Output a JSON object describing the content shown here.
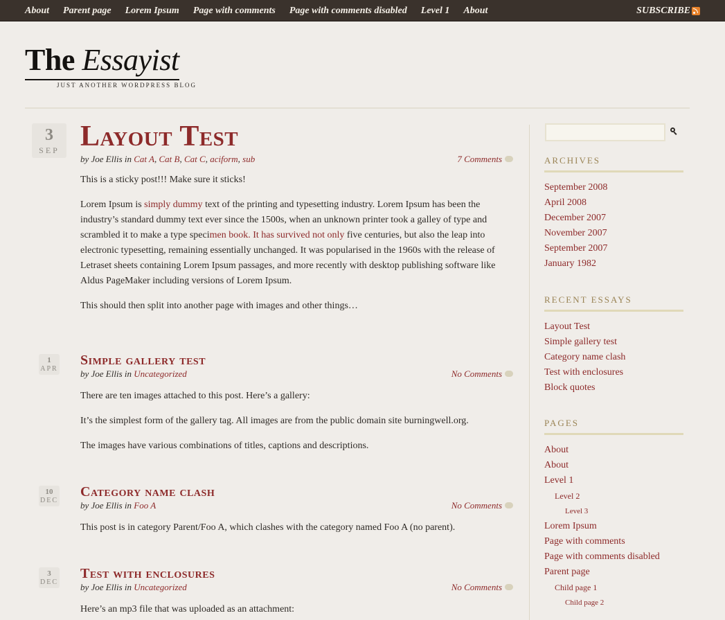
{
  "nav": {
    "items": [
      "About",
      "Parent page",
      "Lorem Ipsum",
      "Page with comments",
      "Page with comments disabled",
      "Level 1",
      "About"
    ],
    "subscribe": "SUBSCRIBE"
  },
  "site": {
    "title_plain": "The ",
    "title_italic": "Essayist",
    "tagline": "Just another WordPress blog"
  },
  "posts": [
    {
      "day": "3",
      "month": "SEP",
      "title": "Layout Test",
      "by": "by Joe Ellis in ",
      "categories": [
        "Cat A",
        "Cat B",
        "Cat C",
        "aciform",
        "sub"
      ],
      "comments": "7 Comments",
      "p1": "This is a sticky post!!! Make sure it sticks!",
      "p2_a": "Lorem Ipsum is ",
      "p2_link1": "simply dummy",
      "p2_b": " text of the printing and typesetting industry. Lorem Ipsum has been the industry’s standard dummy text ever since the 1500s, when an unknown printer took a galley of type and scrambled it to make a type speci",
      "p2_link2": "men book. It has survived not only",
      "p2_c": " five centuries, but also the leap into electronic typesetting, remaining essentially unchanged. It was popularised in the 1960s with the release of Letraset sheets containing Lorem Ipsum passages, and more recently with desktop publishing software like Aldus PageMaker including versions of Lorem Ipsum.",
      "p3": "This should then split into another page with images and other things…"
    },
    {
      "day": "1",
      "month": "APR",
      "title": "Simple gallery test",
      "by": "by Joe Ellis in ",
      "category": "Uncategorized",
      "comments": "No Comments",
      "p1": "There are ten images attached to this post.  Here’s a gallery:",
      "p2": "It’s the simplest form of the gallery tag.  All images are from the public domain site burningwell.org.",
      "p3": "The images have various combinations of titles, captions and descriptions."
    },
    {
      "day": "10",
      "month": "DEC",
      "title": "Category name clash",
      "by": "by Joe Ellis in ",
      "category": "Foo A",
      "comments": "No Comments",
      "p1": "This post is in category Parent/Foo A, which clashes with the category named Foo A (no parent)."
    },
    {
      "day": "3",
      "month": "DEC",
      "title": "Test with enclosures",
      "by": "by Joe Ellis in ",
      "category": "Uncategorized",
      "comments": "No Comments",
      "p1": "Here’s an mp3 file that was uploaded as an attachment:"
    }
  ],
  "sidebar": {
    "search_placeholder": "",
    "archives": {
      "title": "Archives",
      "items": [
        "September 2008",
        "April 2008",
        "December 2007",
        "November 2007",
        "September 2007",
        "January 1982"
      ]
    },
    "recent": {
      "title": "Recent Essays",
      "items": [
        "Layout Test",
        "Simple gallery test",
        "Category name clash",
        "Test with enclosures",
        "Block quotes"
      ]
    },
    "pages": {
      "title": "Pages",
      "items": [
        "About",
        "About",
        "Level 1",
        "Level 2",
        "Level 3",
        "Lorem Ipsum",
        "Page with comments",
        "Page with comments disabled",
        "Parent page",
        "Child page 1",
        "Child page 2"
      ]
    }
  },
  "colors": {
    "accent": "#8d2a2a",
    "topbar": "#3a322c",
    "widget_title": "#9a8455",
    "background": "#f0ede9"
  }
}
